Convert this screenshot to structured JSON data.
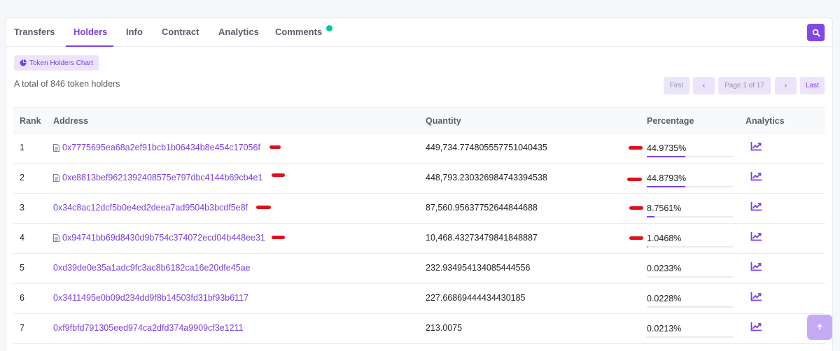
{
  "tabs": [
    {
      "label": "Transfers"
    },
    {
      "label": "Holders"
    },
    {
      "label": "Info"
    },
    {
      "label": "Contract"
    },
    {
      "label": "Analytics"
    },
    {
      "label": "Comments"
    }
  ],
  "chart_button": {
    "label": "Token Holders Chart",
    "icon": "pie-chart-icon"
  },
  "summary": {
    "total_text": "A total of 846 token holders"
  },
  "pagination": {
    "first": "First",
    "prev": "‹",
    "page_info": "Page 1 of 17",
    "next": "›",
    "last": "Last"
  },
  "table": {
    "headers": {
      "rank": "Rank",
      "address": "Address",
      "quantity": "Quantity",
      "percentage": "Percentage",
      "analytics": "Analytics"
    },
    "rows": [
      {
        "rank": "1",
        "address": "0x7775695ea68a2ef91bcb1b06434b8e454c17056f",
        "is_contract": true,
        "quantity": "449,734.774805557751040435",
        "percentage": "44.9735%",
        "pct_value": 44.9735
      },
      {
        "rank": "2",
        "address": "0xe8813bef9621392408575e797dbc4144b69cb4e1",
        "is_contract": true,
        "quantity": "448,793.230326984743394538",
        "percentage": "44.8793%",
        "pct_value": 44.8793
      },
      {
        "rank": "3",
        "address": "0x34c8ac12dcf5b0e4ed2deea7ad9504b3bcdf5e8f",
        "is_contract": false,
        "quantity": "87,560.95637752644844688",
        "percentage": "8.7561%",
        "pct_value": 8.7561
      },
      {
        "rank": "4",
        "address": "0x94741bb69d8430d9b754c374072ecd04b448ee31",
        "is_contract": true,
        "quantity": "10,468.43273479841848887",
        "percentage": "1.0468%",
        "pct_value": 1.0468
      },
      {
        "rank": "5",
        "address": "0xd39de0e35a1adc9fc3ac8b6182ca16e20dfe45ae",
        "is_contract": false,
        "quantity": "232.934954134085444556",
        "percentage": "0.0233%",
        "pct_value": 0.0233
      },
      {
        "rank": "6",
        "address": "0x3411495e0b09d234dd9f8b14503fd31bf93b6117",
        "is_contract": false,
        "quantity": "227.66869444434430185",
        "percentage": "0.0228%",
        "pct_value": 0.0228
      },
      {
        "rank": "7",
        "address": "0xf9fbfd791305eed974ca2dfd374a9909cf3e1211",
        "is_contract": false,
        "quantity": "213.0075",
        "percentage": "0.0213%",
        "pct_value": 0.0213
      }
    ]
  },
  "colors": {
    "accent": "#7b3fe4",
    "annotation": "#e0101c",
    "online_dot": "#00c9a7"
  }
}
